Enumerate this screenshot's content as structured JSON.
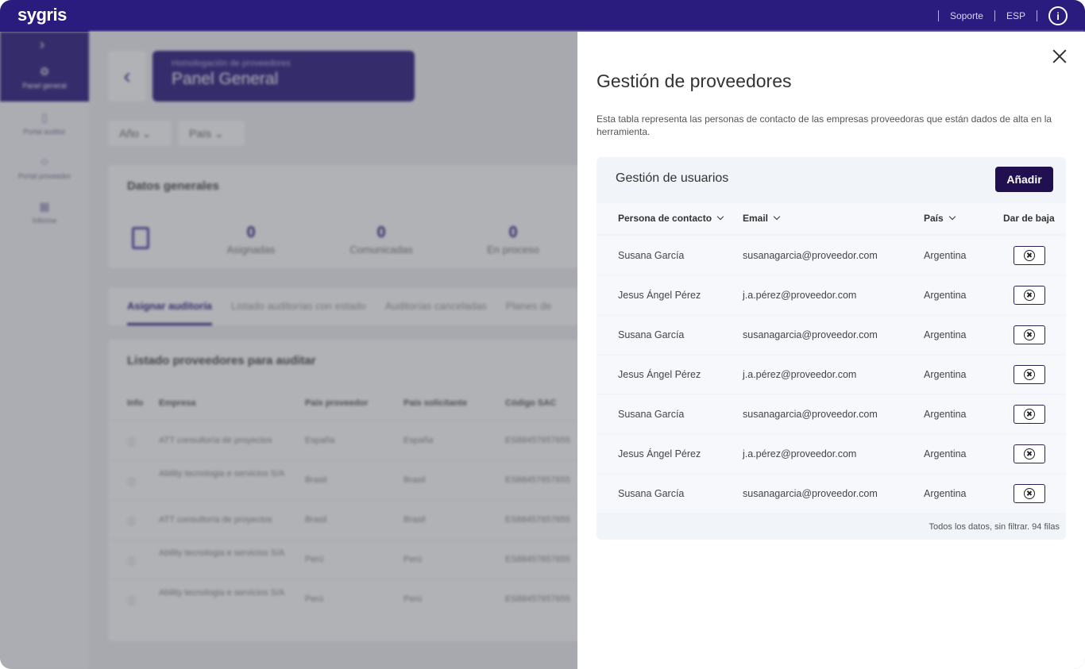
{
  "topbar": {
    "brand": "sygris",
    "support": "Soporte",
    "language": "ESP",
    "info_glyph": "i"
  },
  "sidebar": {
    "items": [
      {
        "label": "Panel general",
        "icon": "gear-icon"
      },
      {
        "label": "Portal auditor",
        "icon": "document-icon"
      },
      {
        "label": "Portal proveedor",
        "icon": "star-icon"
      },
      {
        "label": "Informe",
        "icon": "calendar-icon"
      }
    ]
  },
  "background": {
    "breadcrumb": "Homologación de proveedores",
    "page_title": "Panel General",
    "filters": [
      "Año",
      "País"
    ],
    "general": {
      "title": "Datos generales",
      "kpis": [
        {
          "value": "0",
          "label": "Asignadas"
        },
        {
          "value": "0",
          "label": "Comunicadas"
        },
        {
          "value": "0",
          "label": "En proceso"
        }
      ]
    },
    "tabs": [
      "Asignar auditoría",
      "Listado auditorías con estado",
      "Auditorías canceladas",
      "Planes de"
    ],
    "list": {
      "title": "Listado proveedores para auditar",
      "columns": [
        "Info",
        "Empresa",
        "País proveedor",
        "País solicitante",
        "Código SAC"
      ],
      "rows": [
        [
          "ATT consultoría de proyectos",
          "España",
          "España",
          "ES88457657655"
        ],
        [
          "Ability tecnologia e servicios S/A",
          "Brasil",
          "Brasil",
          "ES88457657655"
        ],
        [
          "ATT consultoría de proyectos",
          "Brasil",
          "Brasil",
          "ES88457657655"
        ],
        [
          "Ability tecnologia e servicios S/A",
          "Perú",
          "Perú",
          "ES88457657655"
        ],
        [
          "Ability tecnologia e servicios S/A",
          "Perú",
          "Perú",
          "ES88457657655"
        ]
      ]
    }
  },
  "drawer": {
    "title": "Gestión de proveedores",
    "description": "Esta tabla representa las personas de contacto de las empresas proveedoras que están dados de alta en la herramienta.",
    "panel": {
      "title": "Gestión de usuarios",
      "add_label": "Añadir",
      "columns": {
        "contact": "Persona de contacto",
        "email": "Email",
        "country": "País",
        "remove": "Dar de baja"
      },
      "rows": [
        {
          "contact": "Susana García",
          "email": "susanagarcia@proveedor.com",
          "country": "Argentina"
        },
        {
          "contact": "Jesus Ángel Pérez",
          "email": "j.a.pérez@proveedor.com",
          "country": "Argentina"
        },
        {
          "contact": "Susana García",
          "email": "susanagarcia@proveedor.com",
          "country": "Argentina"
        },
        {
          "contact": "Jesus Ángel Pérez",
          "email": "j.a.pérez@proveedor.com",
          "country": "Argentina"
        },
        {
          "contact": "Susana García",
          "email": "susanagarcia@proveedor.com",
          "country": "Argentina"
        },
        {
          "contact": "Jesus Ángel Pérez",
          "email": "j.a.pérez@proveedor.com",
          "country": "Argentina"
        },
        {
          "contact": "Susana García",
          "email": "susanagarcia@proveedor.com",
          "country": "Argentina"
        }
      ],
      "footer": "Todos los datos, sin filtrar. 94 filas"
    }
  },
  "colors": {
    "brand": "#2a1b7e",
    "button_dark": "#20104f",
    "panel_bg": "#f1f4f8"
  }
}
